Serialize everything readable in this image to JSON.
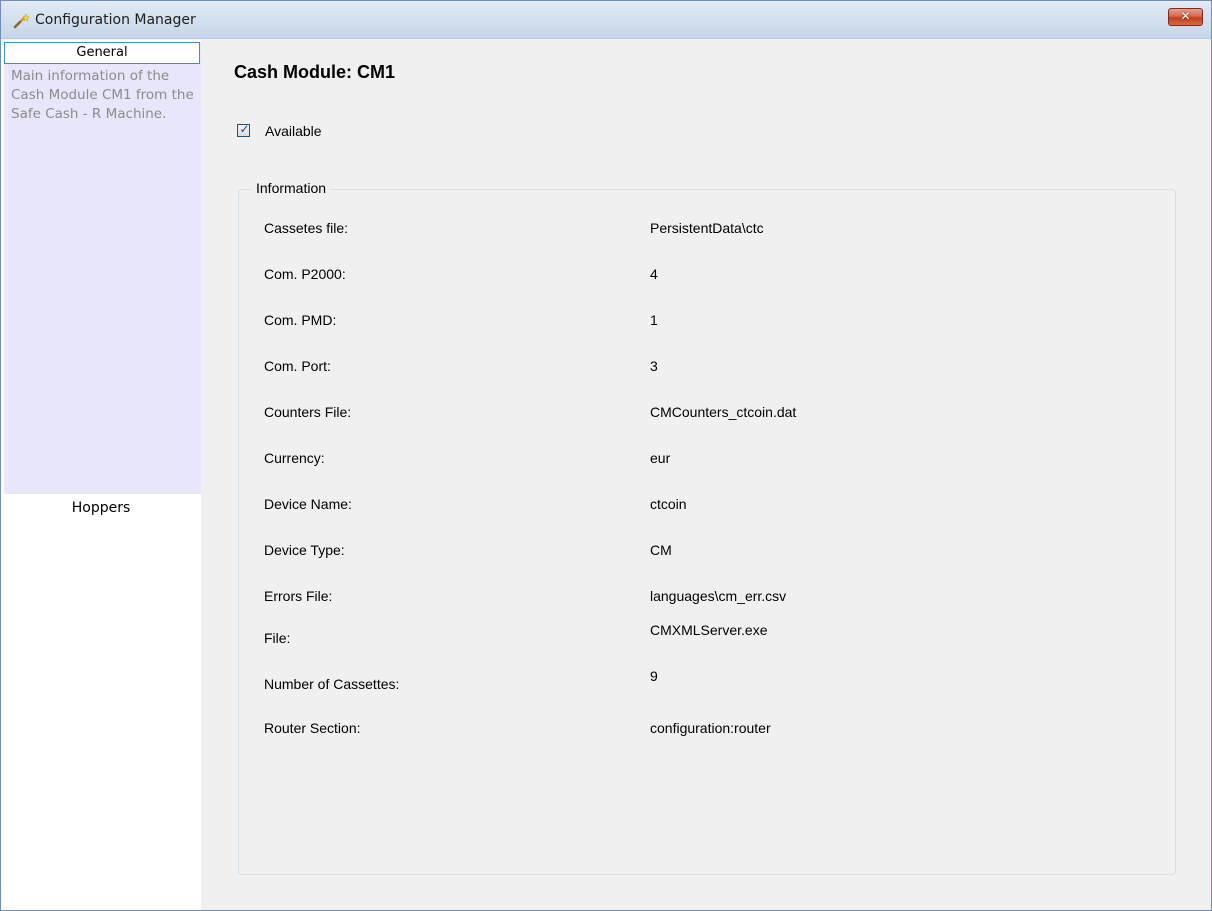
{
  "window": {
    "title": "Configuration Manager",
    "close_label": "✕"
  },
  "sidebar": {
    "general_label": "General",
    "general_description": "Main information of the Cash Module CM1 from the Safe Cash - R Machine.",
    "hoppers_label": "Hoppers"
  },
  "main": {
    "title": "Cash Module: CM1",
    "available_label": "Available",
    "available_checked": true,
    "group_title": "Information",
    "fields": [
      {
        "label": "Cassetes file:",
        "value": "PersistentData\\ctc"
      },
      {
        "label": "Com. P2000:",
        "value": "4"
      },
      {
        "label": "Com. PMD:",
        "value": "1"
      },
      {
        "label": "Com. Port:",
        "value": "3"
      },
      {
        "label": "Counters File:",
        "value": "CMCounters_ctcoin.dat"
      },
      {
        "label": "Currency:",
        "value": "eur"
      },
      {
        "label": "Device Name:",
        "value": "ctcoin"
      },
      {
        "label": "Device Type:",
        "value": "CM"
      },
      {
        "label": "Errors File:",
        "value": "languages\\cm_err.csv"
      },
      {
        "label": "File:",
        "value": "CMXMLServer.exe"
      },
      {
        "label": "Number of Cassettes:",
        "value": "9"
      },
      {
        "label": "Router Section:",
        "value": "configuration:router"
      }
    ]
  },
  "colors": {
    "sidebar_active_bg": "#e8e6fb",
    "sidebar_header_border": "#3d8bd8",
    "sidebar_description_text": "#8c8c8c",
    "close_button": "#c2401e"
  }
}
